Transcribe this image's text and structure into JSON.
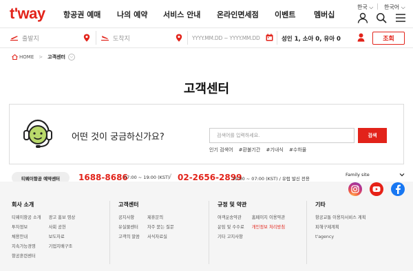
{
  "header": {
    "logo": "t'way",
    "nav": [
      "항공권 예매",
      "나의 예약",
      "서비스 안내",
      "온라인면세점",
      "이벤트",
      "멤버십"
    ],
    "country": "한국 ⌵",
    "language": "한국어 ⌵",
    "icons": [
      "user-icon",
      "search-icon",
      "menu-icon"
    ]
  },
  "booking": {
    "departure_placeholder": "출발지",
    "arrival_placeholder": "도착지",
    "date_placeholder": "YYYY.MM.DD  ~ YYYY.MM.DD",
    "passengers": "성인 1, 소아 0, 유아 0",
    "search_label": "조회"
  },
  "breadcrumb": {
    "home": "HOME",
    "current": "고객센터"
  },
  "page_title": "고객센터",
  "faq": {
    "question": "어떤 것이 궁금하신가요?",
    "placeholder": "검색어를 입력하세요.",
    "search_label": "검색",
    "popular_label": "인기 검색어",
    "popular_terms": [
      "#환불기간",
      "#기내식",
      "#수하물"
    ]
  },
  "contact": {
    "reservation_label": "티웨이항공 예약센터",
    "phone_domestic": "1688-8686",
    "hours_domestic": "07:00 ~ 19:00 (KST)",
    "separator": "/",
    "phone_overseas": "02-2656-2899",
    "hours_overseas": "19:00 ~ 07:00 (KST) / 유럽 발신 전용",
    "family_site": "Family site"
  },
  "footer": {
    "company": {
      "title": "회사 소개",
      "links": [
        "티웨이항공 소개",
        "광고 홍보 영상",
        "투자정보",
        "사회 공헌",
        "채용안내",
        "보도자료",
        "지속가능경영",
        "기업지배구조",
        "항공훈련센터"
      ]
    },
    "service": {
      "title": "고객센터",
      "links": [
        "공지사항",
        "제휴문의",
        "유실물센터",
        "자주 묻는 질문",
        "고객의 말씀",
        "서식자료실"
      ]
    },
    "policy": {
      "title": "규정 및 약관",
      "links": [
        "여객운송약관",
        "홈페이지 이용약관",
        "운임 및 수수료",
        "개인정보 처리방침",
        "기타 고지사항"
      ]
    },
    "etc": {
      "title": "기타",
      "links": [
        "항공교통 이용자서비스 계획",
        "피해구제계획",
        "t'agency"
      ]
    }
  },
  "colors": {
    "brand_red": "#e2231a",
    "footer_bg": "#f5f5f5"
  }
}
